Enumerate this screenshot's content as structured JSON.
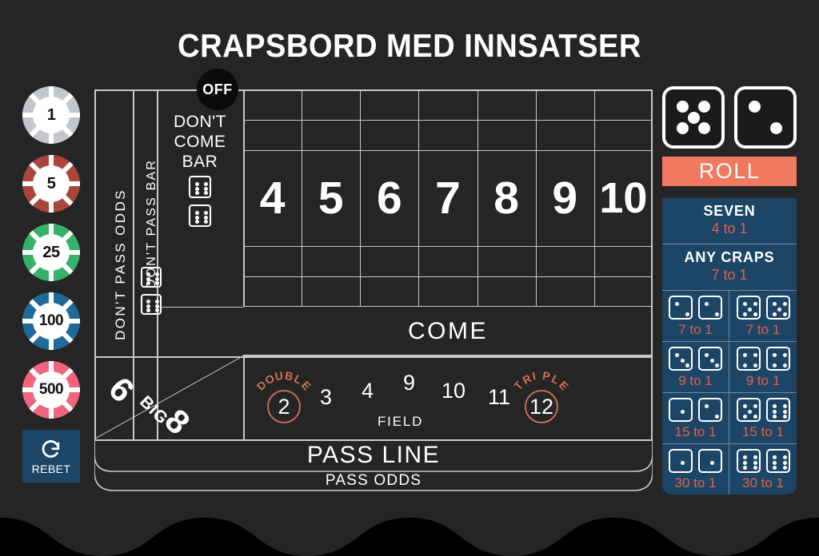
{
  "page": {
    "title": "CRAPSBORD MED INNSATSER",
    "background_color": "#252525",
    "line_color": "#c9c9c9",
    "accent_color": "#f0795f",
    "panel_color": "#1d4565",
    "odds_text_color": "#e2624a"
  },
  "chips": [
    {
      "value": "1",
      "color": "#c3c7cb",
      "name": "chip-1"
    },
    {
      "value": "5",
      "color": "#a9453a",
      "name": "chip-5"
    },
    {
      "value": "25",
      "color": "#35b267",
      "name": "chip-25"
    },
    {
      "value": "100",
      "color": "#1f6a99",
      "name": "chip-100"
    },
    {
      "value": "500",
      "color": "#f0647e",
      "name": "chip-500"
    }
  ],
  "rebet": {
    "label": "REBET",
    "icon": "refresh-circular-arrow-icon"
  },
  "board": {
    "dont_pass_odds": "DON'T PASS ODDS",
    "dont_pass_bar": "DON'T PASS BAR",
    "dont_pass_bar_dice": [
      6,
      6
    ],
    "dont_come_bar": "DON'T COME BAR",
    "dont_come_bar_lines": [
      "DON'T",
      "COME",
      "BAR"
    ],
    "dont_come_bar_dice": [
      6,
      6
    ],
    "puck": "OFF",
    "numbers": [
      "4",
      "5",
      "6",
      "7",
      "8",
      "9",
      "10"
    ],
    "come": "COME",
    "big68": {
      "six": "6",
      "big": "BIG",
      "eight": "8"
    },
    "field": {
      "label": "FIELD",
      "double": "DOUBLE",
      "triple": "TRIPLE",
      "numbers": [
        "2",
        "3",
        "4",
        "9",
        "10",
        "11",
        "12"
      ]
    },
    "pass_line": "PASS LINE",
    "pass_odds": "PASS ODDS"
  },
  "right_panel": {
    "dice_result": [
      5,
      2
    ],
    "roll_button": "ROLL",
    "bets": [
      {
        "name": "SEVEN",
        "odds": "4 to 1"
      },
      {
        "name": "ANY CRAPS",
        "odds": "7 to 1"
      }
    ],
    "hardways": [
      {
        "dice": [
          2,
          2
        ],
        "odds": "7 to 1"
      },
      {
        "dice": [
          5,
          5
        ],
        "odds": "7 to 1"
      },
      {
        "dice": [
          3,
          3
        ],
        "odds": "9 to 1"
      },
      {
        "dice": [
          4,
          4
        ],
        "odds": "9 to 1"
      },
      {
        "dice": [
          1,
          2
        ],
        "odds": "15 to 1"
      },
      {
        "dice": [
          5,
          6
        ],
        "odds": "15 to 1"
      },
      {
        "dice": [
          1,
          1
        ],
        "odds": "30 to 1"
      },
      {
        "dice": [
          6,
          6
        ],
        "odds": "30 to 1"
      }
    ]
  }
}
